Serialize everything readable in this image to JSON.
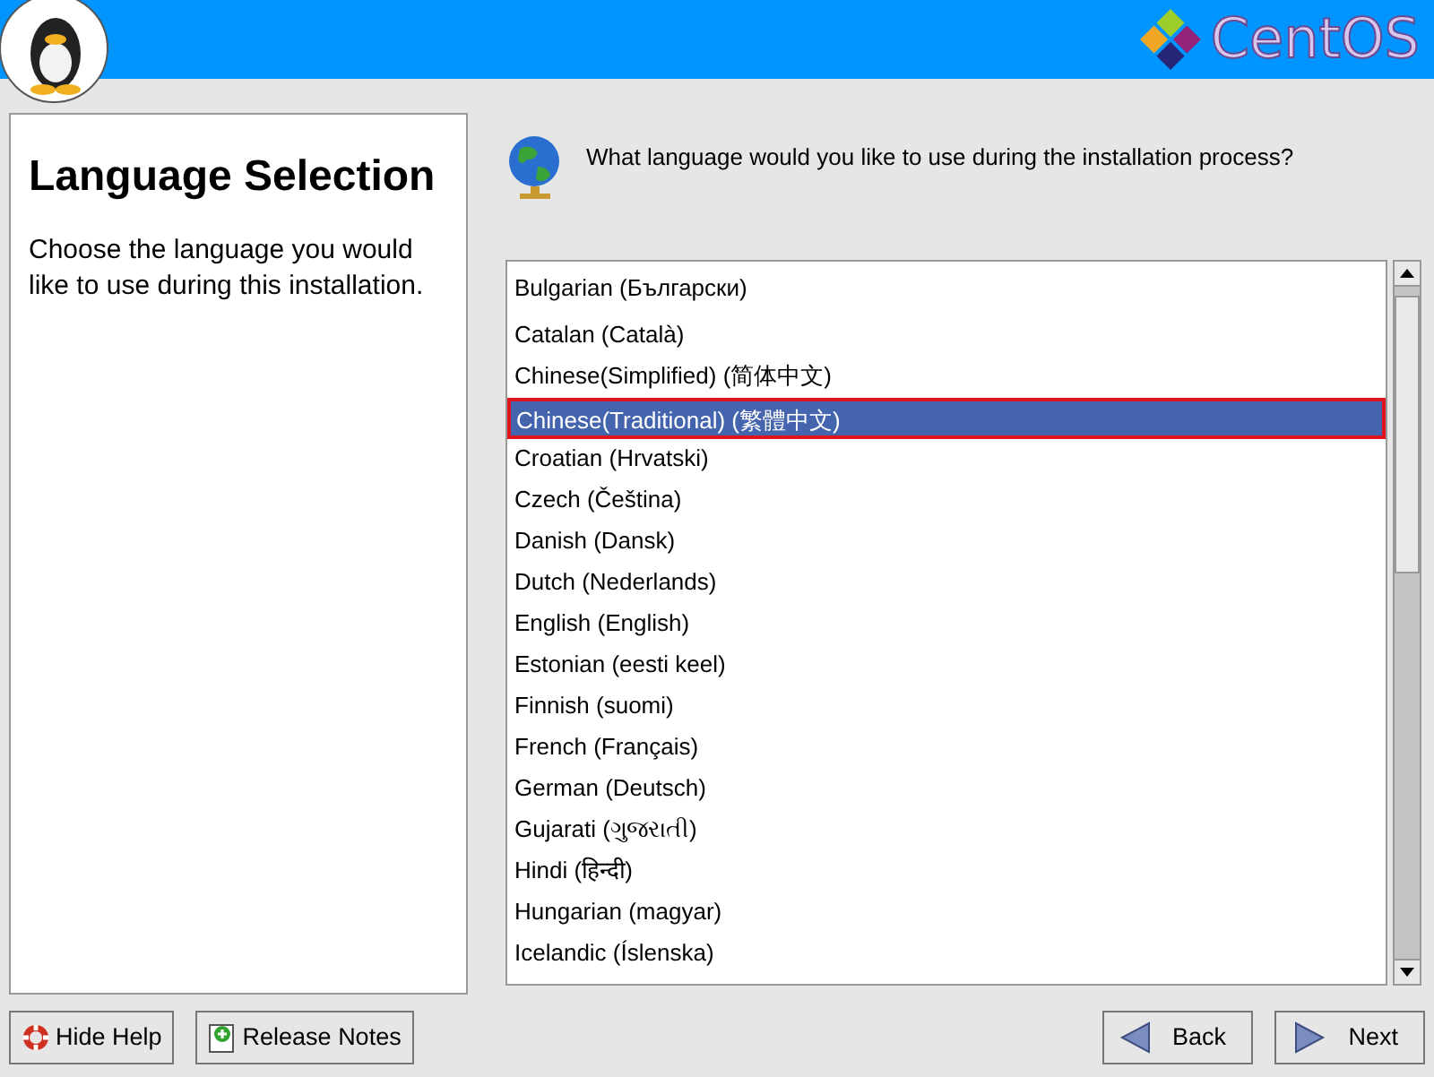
{
  "header": {
    "logo_text": "CentOS"
  },
  "help_panel": {
    "title": "Language Selection",
    "text": "Choose the language you would like to use during this installation."
  },
  "question": "What language would you like to use during the installation process?",
  "languages": [
    {
      "label": "Bulgarian (Български)",
      "selected": false
    },
    {
      "label": "Catalan (Català)",
      "selected": false
    },
    {
      "label": "Chinese(Simplified) (简体中文)",
      "selected": false
    },
    {
      "label": "Chinese(Traditional) (繁體中文)",
      "selected": true
    },
    {
      "label": "Croatian (Hrvatski)",
      "selected": false
    },
    {
      "label": "Czech (Čeština)",
      "selected": false
    },
    {
      "label": "Danish (Dansk)",
      "selected": false
    },
    {
      "label": "Dutch (Nederlands)",
      "selected": false
    },
    {
      "label": "English (English)",
      "selected": false
    },
    {
      "label": "Estonian (eesti keel)",
      "selected": false
    },
    {
      "label": "Finnish (suomi)",
      "selected": false
    },
    {
      "label": "French (Français)",
      "selected": false
    },
    {
      "label": "German (Deutsch)",
      "selected": false
    },
    {
      "label": "Gujarati (ગુજરાતી)",
      "selected": false
    },
    {
      "label": "Hindi (हिन्दी)",
      "selected": false
    },
    {
      "label": "Hungarian (magyar)",
      "selected": false
    },
    {
      "label": "Icelandic (Íslenska)",
      "selected": false
    }
  ],
  "buttons": [
    {
      "kind": "help",
      "label": "Hide Help"
    },
    {
      "kind": "notes",
      "label": "Release Notes"
    },
    {
      "kind": "back",
      "label": "Back"
    },
    {
      "kind": "next",
      "label": "Next"
    }
  ]
}
